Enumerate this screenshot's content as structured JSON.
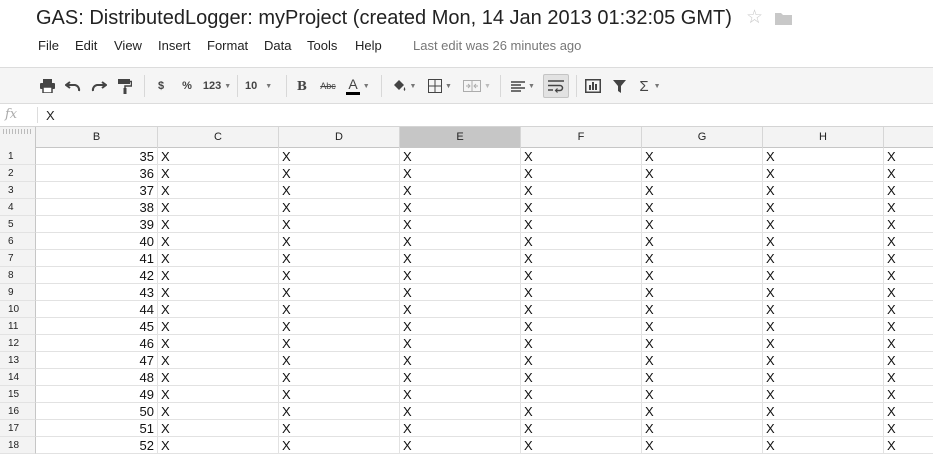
{
  "header": {
    "title": "GAS: DistributedLogger: myProject (created Mon, 14 Jan 2013 01:32:05 GMT)",
    "star_glyph": "☆",
    "last_edit": "Last edit was 26 minutes ago"
  },
  "menu": [
    "File",
    "Edit",
    "View",
    "Insert",
    "Format",
    "Data",
    "Tools",
    "Help"
  ],
  "toolbar": {
    "currency": "$",
    "percent": "%",
    "number_format": "123",
    "font_size": "10",
    "bold": "B",
    "strike": "Abc",
    "text_color": "A",
    "sum": "Σ"
  },
  "formula_bar": {
    "fx_label": "fx",
    "value": "X"
  },
  "columns": [
    "B",
    "C",
    "D",
    "E",
    "F",
    "G",
    "H",
    ""
  ],
  "selected_column": "E",
  "rows": [
    {
      "num": "1",
      "b": "35"
    },
    {
      "num": "2",
      "b": "36"
    },
    {
      "num": "3",
      "b": "37"
    },
    {
      "num": "4",
      "b": "38"
    },
    {
      "num": "5",
      "b": "39"
    },
    {
      "num": "6",
      "b": "40"
    },
    {
      "num": "7",
      "b": "41"
    },
    {
      "num": "8",
      "b": "42"
    },
    {
      "num": "9",
      "b": "43"
    },
    {
      "num": "10",
      "b": "44"
    },
    {
      "num": "11",
      "b": "45"
    },
    {
      "num": "12",
      "b": "46"
    },
    {
      "num": "13",
      "b": "47"
    },
    {
      "num": "14",
      "b": "48"
    },
    {
      "num": "15",
      "b": "49"
    },
    {
      "num": "16",
      "b": "50"
    },
    {
      "num": "17",
      "b": "51"
    },
    {
      "num": "18",
      "b": "52"
    }
  ],
  "cell_value": "X",
  "colors": {
    "selected_column_header": "#c6c6c6",
    "header_bg": "#f3f3f3",
    "text_color_underline": "#000000"
  }
}
